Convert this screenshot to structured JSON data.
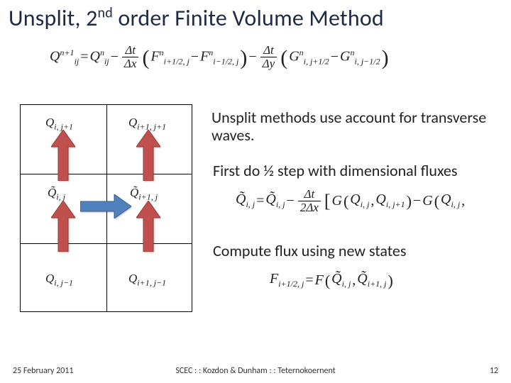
{
  "title": {
    "pre": "Unsplit, 2",
    "sup": "nd",
    "post": " order Finite Volume Method"
  },
  "main_eq": {
    "Q_lhs_base": "Q",
    "Q_lhs_sup": "n+1",
    "Q_lhs_sub": "ij",
    "eq": " = ",
    "Q_rhs_base": "Q",
    "Q_rhs_sup": "n",
    "Q_rhs_sub": "ij",
    "minus": " − ",
    "frac1_num": "Δt",
    "frac1_den": "Δx",
    "F1_base": "F",
    "F1_sup": "n",
    "F1_sub": "i+1/2, j",
    "F2_base": "F",
    "F2_sup": "n",
    "F2_sub": "i−1/2, j",
    "frac2_num": "Δt",
    "frac2_den": "Δy",
    "G1_base": "G",
    "G1_sup": "n",
    "G1_sub": "i, j+1/2",
    "G2_base": "G",
    "G2_sup": "n",
    "G2_sub": "i, j−1/2"
  },
  "explain": {
    "p1": "Unsplit methods use account for transverse waves.",
    "p2": "First do ½ step with dimensional fluxes",
    "p3": "Compute flux using new states"
  },
  "eq2": {
    "Qt_lhs": "Q̃",
    "Qt_lhs_sub": "i, j",
    "eq": " = ",
    "Qt_rhs": "Q̃",
    "Qt_rhs_sub": "i, j",
    "minus": " − ",
    "frac_num": "Δt",
    "frac_den": "2Δx",
    "G": "G",
    "Q1": "Q",
    "Q1_sub": "i, j",
    "Q2": "Q",
    "Q2_sub": "i, j+1",
    "G2": "G",
    "Q3": "Q",
    "Q3_sub": "i, j"
  },
  "eq3": {
    "F": "F",
    "F_sub": "i+1/2, j",
    "eq": " = ",
    "Ff": "F",
    "Qt1": "Q̃",
    "Qt1_sub": "i, j",
    "Qt2": "Q̃",
    "Qt2_sub": "i+1, j"
  },
  "grid_labels": {
    "c00": "Q",
    "c00_sub": "i, j+1",
    "c01": "Q",
    "c01_sub": "i+1, j+1",
    "c10": "Q̃",
    "c10_sub": "i, j",
    "c11": "Q̃",
    "c11_sub": "i+1, j",
    "c20": "Q",
    "c20_sub": "i, j−1",
    "c21": "Q",
    "c21_sub": "i+1, j−1"
  },
  "footer": {
    "date": "25 February 2011",
    "center": "SCEC : : Kozdon & Dunham : : Teternokoernent",
    "page": "12"
  }
}
